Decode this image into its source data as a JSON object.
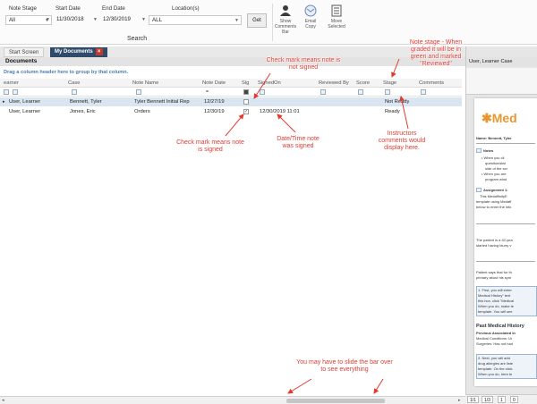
{
  "filters": {
    "note_stage": {
      "label": "Note Stage",
      "value": "All"
    },
    "start_date": {
      "label": "Start Date",
      "value": "11/30/2018"
    },
    "end_date": {
      "label": "End Date",
      "value": "12/30/2019"
    },
    "locations": {
      "label": "Location(s)",
      "value": "ALL"
    },
    "get_label": "Get",
    "search_label": "Search"
  },
  "ribbon_buttons": [
    {
      "label": "Show Comments Bar",
      "icon": "person-icon"
    },
    {
      "label": "Email Copy",
      "icon": "email-icon"
    },
    {
      "label": "Move Selected",
      "icon": "document-icon"
    }
  ],
  "tabs": [
    {
      "label": "Start Screen",
      "active": false
    },
    {
      "label": "My Documents",
      "active": true
    }
  ],
  "panel_title": "Documents",
  "group_hint": "Drag a column header here to group by that column.",
  "columns": [
    "earner",
    "Case",
    "Note Name",
    "Note Date",
    "Sig",
    "SignedOn",
    "Reviewed By",
    "Score",
    "Stage",
    "Comments"
  ],
  "rows": [
    {
      "learner": "User, Learner",
      "case": "Bennett, Tyler",
      "note_name": "Tyler Bennett Initial Rep",
      "note_date": "12/27/19",
      "sig": "",
      "signed_on": "",
      "reviewed_by": "",
      "score": "",
      "stage": "Not Ready",
      "comments": ""
    },
    {
      "learner": "User, Learner",
      "case": "Jones, Eric",
      "note_name": "Orders",
      "note_date": "12/30/19",
      "sig": "✓",
      "signed_on": "12/30/2019 11:01",
      "reviewed_by": "",
      "score": "",
      "stage": "Ready",
      "comments": ""
    }
  ],
  "annotations": {
    "note_stage": "Note stage - When graded it will be in green and marked \"Reviewed\"",
    "check_not_signed": "Check mark means note is not signed",
    "check_signed": "Check mark means note is signed",
    "datetime": "Date/Time note was signed",
    "instructors": "Instructors comments would display here.",
    "slide_bar": "You may have to slide the bar over to see everything"
  },
  "preview": {
    "header": "User, Learner  Case",
    "logo": "Med",
    "name_line": "Name: Bennett, Tyler",
    "notes_title": "Notes",
    "note_bullets": [
      "When you cli",
      "question/stat",
      "side of the scr",
      "When you are",
      "program wind"
    ],
    "assignment_title": "Assignment 1:",
    "assignment_lines": [
      "This MedaffinityE",
      "template using Medaff",
      "below to enter the info"
    ],
    "patient_lines": [
      "The patient is a 42-yea",
      "started having blurry v"
    ],
    "patient_says": [
      "Patient says that for th",
      "primary about his sym"
    ],
    "step1": [
      "1. First, you will enter",
      "Medical History\" text",
      "this box, click \"Medical",
      "When you do, make te",
      "template. You will see"
    ],
    "pmh_title": "Past Medical History",
    "pmh_lines": [
      "Previous Associated In",
      "Medical Conditions: Ur",
      "Surgeries: Has not had"
    ],
    "step2": [
      "2. Next, you will add",
      "drug allergies are liste",
      "template. On the click",
      "When you do, here te"
    ]
  },
  "pager": [
    "1/1",
    "1/3",
    "1",
    "0"
  ],
  "colors": {
    "annotation": "#e23a2f",
    "active_tab": "#2e4b6b",
    "link": "#4a7db5"
  }
}
